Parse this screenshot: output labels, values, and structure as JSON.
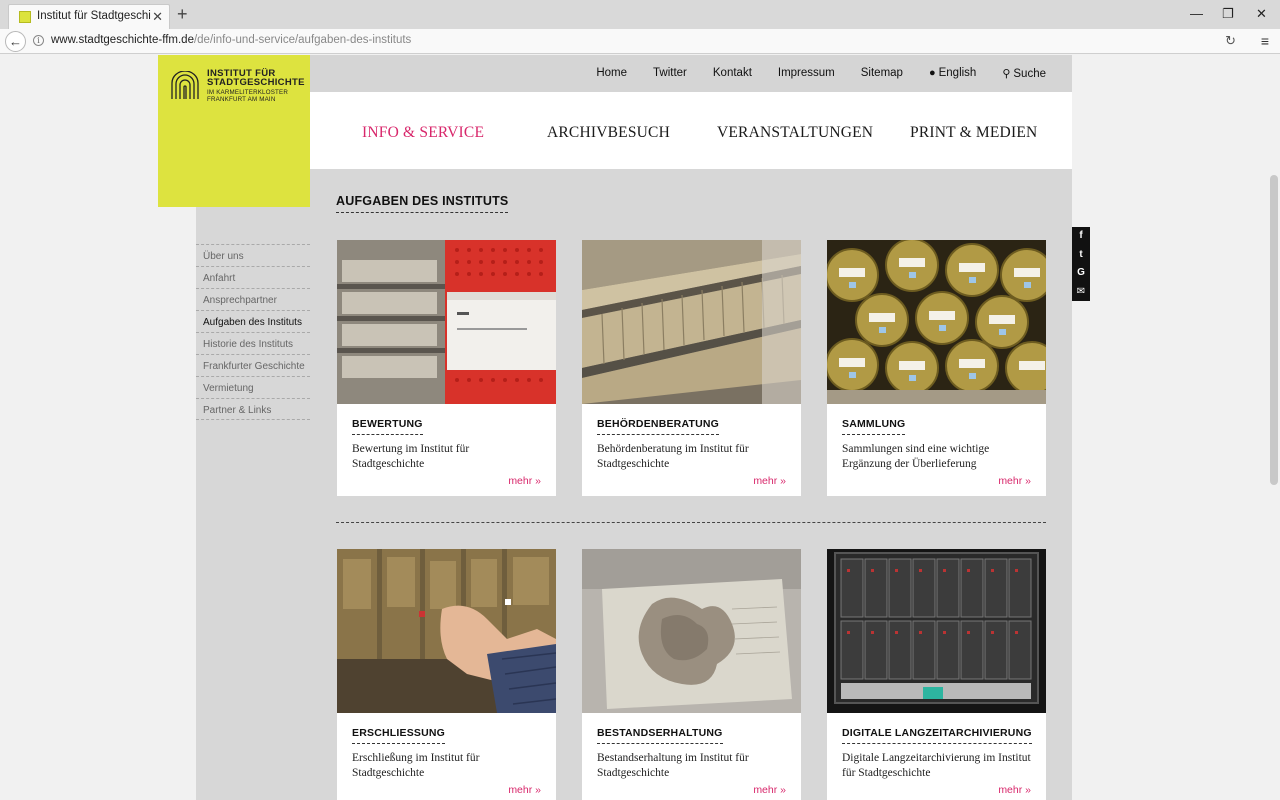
{
  "browser": {
    "tab_title": "Institut für Stadtgeschicht…",
    "tab_close": "✕",
    "new_tab": "+",
    "url_host": "www.stadtgeschichte-ffm.de",
    "url_path": "/de/info-und-service/aufgaben-des-instituts",
    "window_minimize": "—",
    "window_maximize": "❐",
    "window_close": "✕",
    "back": "←",
    "info": "i",
    "reload": "↻",
    "menu": "≡"
  },
  "logo": {
    "line1": "INSTITUT FÜR",
    "line2": "STADTGESCHICHTE",
    "line3": "IM KARMELITERKLOSTER",
    "line4": "FRANKFURT AM MAIN"
  },
  "top_nav": {
    "home": "Home",
    "twitter": "Twitter",
    "contact": "Kontakt",
    "imprint": "Impressum",
    "sitemap": "Sitemap",
    "english": "English",
    "search": "Suche",
    "globe_glyph": "●",
    "search_glyph": "⚲"
  },
  "main_nav": [
    "INFO & SERVICE",
    "ARCHIVBESUCH",
    "VERANSTALTUNGEN",
    "PRINT & MEDIEN"
  ],
  "sub_nav": [
    "Über uns",
    "Anfahrt",
    "Ansprechpartner",
    "Aufgaben des Instituts",
    "Historie des Instituts",
    "Frankfurter Geschichte",
    "Vermietung",
    "Partner & Links"
  ],
  "page_title": "AUFGABEN DES INSTITUTS",
  "more_label": "mehr »",
  "cards": [
    {
      "title": "BEWERTUNG",
      "desc": "Bewertung im Institut für Stadtgeschichte"
    },
    {
      "title": "BEHÖRDENBERATUNG",
      "desc": "Behördenberatung im Institut für Stadtgeschichte"
    },
    {
      "title": "SAMMLUNG",
      "desc": "Sammlungen sind eine wichtige Ergänzung der Überlieferung"
    },
    {
      "title": "ERSCHLIESSUNG",
      "desc": "Erschließung im Institut für Stadtgeschichte"
    },
    {
      "title": "BESTANDSERHALTUNG",
      "desc": "Bestandserhaltung im Institut für Stadtgeschichte"
    },
    {
      "title": "DIGITALE LANGZEITARCHIVIERUNG",
      "desc": "Digitale Langzeitarchivierung im Institut für Stadtgeschichte"
    }
  ],
  "social": {
    "facebook": "f",
    "twitter": "t",
    "google": "G",
    "mail": "✉"
  },
  "colors": {
    "accent": "#d8276b",
    "logo_bg": "#dde33f"
  }
}
